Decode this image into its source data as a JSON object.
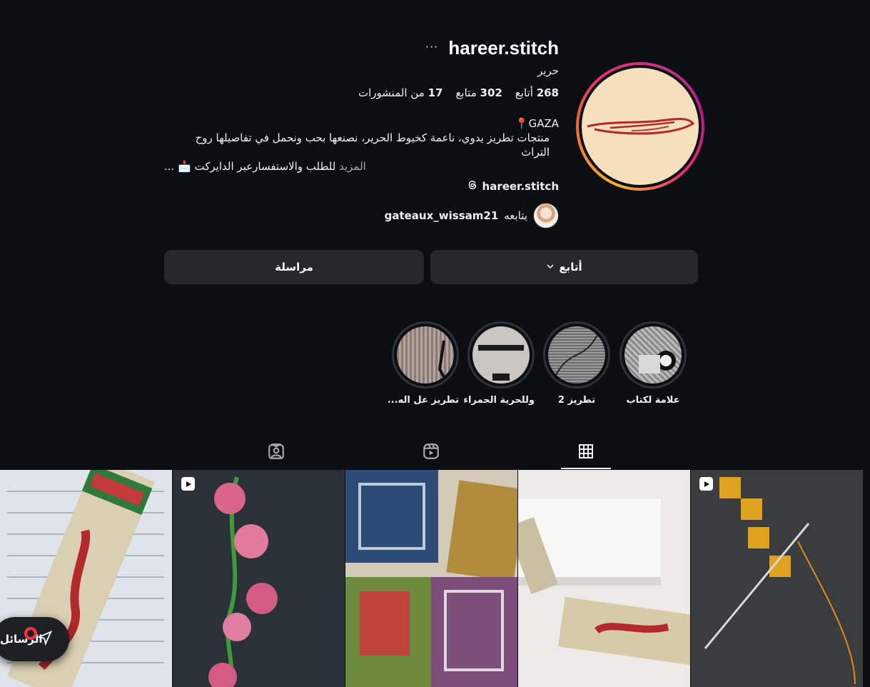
{
  "profile": {
    "username": "hareer.stitch",
    "more_icon": "···",
    "full_name": "حرير",
    "stats": {
      "posts_count": "17",
      "posts_label": "من المنشورات",
      "followers_count": "302",
      "followers_label": "متابع",
      "following_count": "268",
      "following_label": "أتابع"
    },
    "bio": {
      "location": "📍GAZA",
      "line2": "منتجات تطريز يدوي، ناعمة كخيوط الحرير، نصنعها بحب ونحمل في تفاصيلها روح التراث",
      "line3": "للطلب والاستفسارعبر الدايركت 📩 ...",
      "more": "المزيد"
    },
    "threads_handle": "hareer.stitch",
    "followed_by_label": "يتابعه",
    "followed_by_user": "gateaux_wissam21"
  },
  "buttons": {
    "follow": "أتابع",
    "message": "مراسلة"
  },
  "highlights": [
    {
      "label": "علامة لكتاب",
      "icon": "highlight-bookmark"
    },
    {
      "label": "تطريز 2",
      "icon": "highlight-embroidery"
    },
    {
      "label": "وللحرية الحمراء",
      "icon": "highlight-red"
    },
    {
      "label": "تطريز عل اله...",
      "icon": "highlight-coming"
    }
  ],
  "tabs": [
    "posts-grid-icon",
    "reels-icon",
    "tagged-icon"
  ],
  "messages_fab": {
    "label": "الرسائل",
    "badge_color": "#ff3040"
  },
  "colors": {
    "background": "#0b0e13",
    "button": "#25292e",
    "avatar_bg": "#f5dfbd",
    "logo_red": "#b32a2a"
  }
}
